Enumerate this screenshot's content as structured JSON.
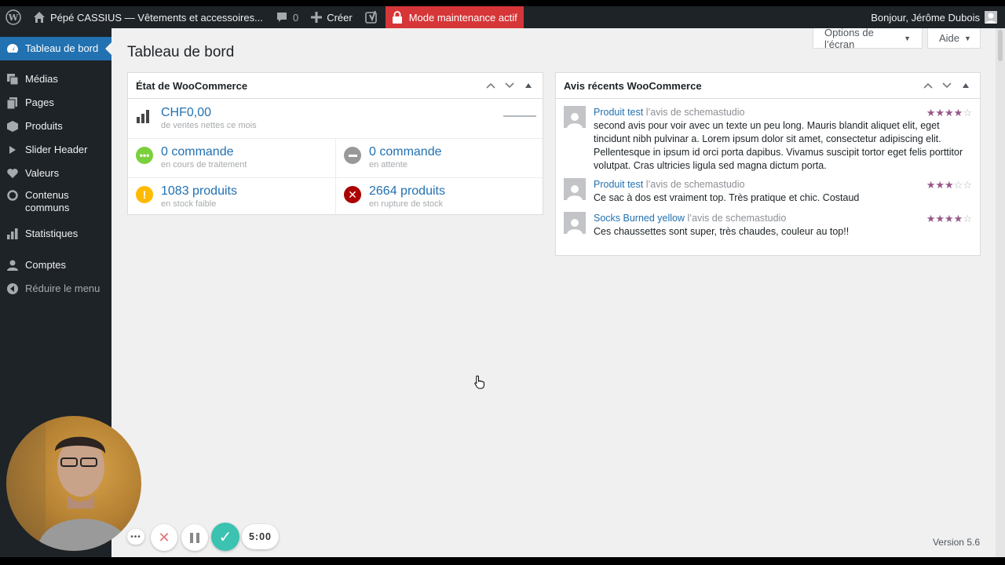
{
  "adminbar": {
    "site_name": "Pépé CASSIUS — Vêtements et accessoires...",
    "comments_count": "0",
    "new_label": "Créer",
    "maintenance_label": "Mode maintenance actif",
    "greeting": "Bonjour, Jérôme Dubois"
  },
  "sidebar": {
    "items": [
      {
        "label": "Tableau de bord",
        "icon": "dashboard-icon"
      },
      {
        "label": "Médias",
        "icon": "media-icon"
      },
      {
        "label": "Pages",
        "icon": "pages-icon"
      },
      {
        "label": "Produits",
        "icon": "products-icon"
      },
      {
        "label": "Slider Header",
        "icon": "slider-icon"
      },
      {
        "label": "Valeurs",
        "icon": "heart-icon"
      },
      {
        "label": "Contenus communs",
        "icon": "circle-icon"
      },
      {
        "label": "Statistiques",
        "icon": "stats-icon"
      },
      {
        "label": "Comptes",
        "icon": "user-icon"
      }
    ],
    "collapse_label": "Réduire le menu"
  },
  "header": {
    "title": "Tableau de bord",
    "screen_options": "Options de l’écran",
    "help": "Aide"
  },
  "woo_status": {
    "title": "État de WooCommerce",
    "sales_value": "CHF0,00",
    "sales_label": "de ventes nettes ce mois",
    "processing_value": "0 commande",
    "processing_label": "en cours de traitement",
    "onhold_value": "0 commande",
    "onhold_label": "en attente",
    "lowstock_value": "1083 produits",
    "lowstock_label": "en stock faible",
    "outofstock_value": "2664 produits",
    "outofstock_label": "en rupture de stock"
  },
  "reviews": {
    "title": "Avis récents WooCommerce",
    "items": [
      {
        "product": "Produit test",
        "by": "l’avis de schemastudio",
        "text": "second avis pour voir avec un texte un peu long. Mauris blandit aliquet elit, eget tincidunt nibh pulvinar a. Lorem ipsum dolor sit amet, consectetur adipiscing elit. Pellentesque in ipsum id orci porta dapibus. Vivamus suscipit tortor eget felis porttitor volutpat. Cras ultricies ligula sed magna dictum porta.",
        "rating": 4
      },
      {
        "product": "Produit test",
        "by": "l’avis de schemastudio",
        "text": "Ce sac à dos est vraiment top. Très pratique et chic. Costaud",
        "rating": 3
      },
      {
        "product": "Socks Burned yellow",
        "by": "l’avis de schemastudio",
        "text": "Ces chaussettes sont super, très chaudes, couleur au top!!",
        "rating": 4
      }
    ]
  },
  "footer": {
    "version": "Version 5.6"
  },
  "recorder": {
    "timer": "5:00"
  },
  "colors": {
    "admin_dark": "#1d2327",
    "accent_blue": "#2271b1",
    "maintenance_red": "#d63638",
    "star_purple": "#96588a",
    "content_bg": "#f0f0f1",
    "status_green": "#7ad03a",
    "status_yellow": "#ffba00",
    "status_red": "#a00",
    "status_gray": "#999"
  }
}
